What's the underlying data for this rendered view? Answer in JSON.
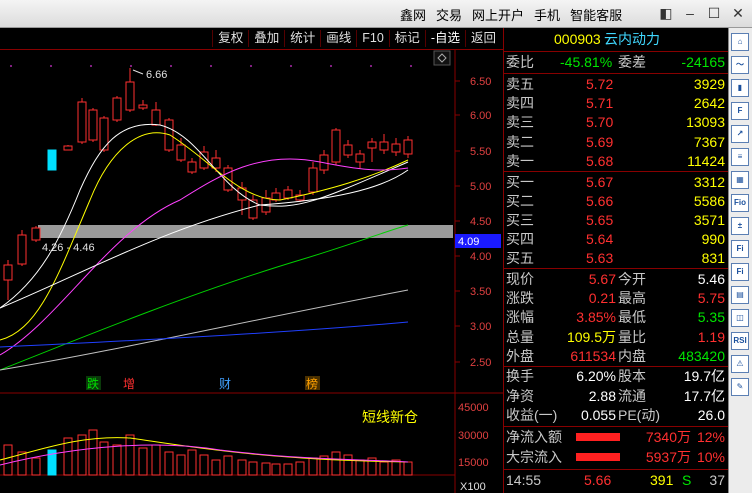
{
  "menu": [
    "鑫网",
    "交易",
    "网上开户",
    "手机",
    "智能客服"
  ],
  "toolbar": [
    "复权",
    "叠加",
    "统计",
    "画线",
    "F10",
    "标记",
    "-自选",
    "返回"
  ],
  "stock": {
    "code": "000903",
    "name": "云内动力"
  },
  "weibi": {
    "label": "委比",
    "value": "-45.81%",
    "label2": "委差",
    "value2": "-24165"
  },
  "asks": [
    {
      "label": "卖五",
      "price": "5.72",
      "vol": "3929"
    },
    {
      "label": "卖四",
      "price": "5.71",
      "vol": "2642"
    },
    {
      "label": "卖三",
      "price": "5.70",
      "vol": "13093"
    },
    {
      "label": "卖二",
      "price": "5.69",
      "vol": "7367"
    },
    {
      "label": "卖一",
      "price": "5.68",
      "vol": "11424"
    }
  ],
  "bids": [
    {
      "label": "买一",
      "price": "5.67",
      "vol": "3312"
    },
    {
      "label": "买二",
      "price": "5.66",
      "vol": "5586"
    },
    {
      "label": "买三",
      "price": "5.65",
      "vol": "3571"
    },
    {
      "label": "买四",
      "price": "5.64",
      "vol": "990"
    },
    {
      "label": "买五",
      "price": "5.63",
      "vol": "831"
    }
  ],
  "quote": [
    {
      "l1": "现价",
      "v1": "5.67",
      "c1": "red",
      "l2": "今开",
      "v2": "5.46",
      "c2": "wht"
    },
    {
      "l1": "涨跌",
      "v1": "0.21",
      "c1": "red",
      "l2": "最高",
      "v2": "5.75",
      "c2": "red"
    },
    {
      "l1": "涨幅",
      "v1": "3.85%",
      "c1": "red",
      "l2": "最低",
      "v2": "5.35",
      "c2": "grn"
    },
    {
      "l1": "总量",
      "v1": "109.5万",
      "c1": "yel",
      "l2": "量比",
      "v2": "1.19",
      "c2": "red"
    },
    {
      "l1": "外盘",
      "v1": "611534",
      "c1": "red",
      "l2": "内盘",
      "v2": "483420",
      "c2": "grn"
    }
  ],
  "fund": [
    {
      "l1": "换手",
      "v1": "6.20%",
      "l2": "股本",
      "v2": "19.7亿"
    },
    {
      "l1": "净资",
      "v1": "2.88",
      "l2": "流通",
      "v2": "17.7亿"
    },
    {
      "l1": "收益(一)",
      "v1": "0.055",
      "l2": "PE(动)",
      "v2": "26.0"
    }
  ],
  "flow": [
    {
      "label": "净流入额",
      "value": "7340万",
      "pct": "12%"
    },
    {
      "label": "大宗流入",
      "value": "5937万",
      "pct": "10%"
    }
  ],
  "tick": {
    "time": "14:55",
    "price": "5.66",
    "vol": "391",
    "side": "S",
    "n": "37"
  },
  "chart": {
    "price_axis": [
      "6.50",
      "6.00",
      "5.50",
      "5.00",
      "4.50",
      "4.00",
      "3.50",
      "3.00",
      "2.50"
    ],
    "current_price_tag": "4.09",
    "high_label": "6.66",
    "range_label": "4.26 - 4.46",
    "event_marks": [
      "跌",
      "增",
      "财",
      "榜"
    ],
    "vol_axis": [
      "45000",
      "30000",
      "15000"
    ],
    "vol_unit": "X100",
    "annotation": "短线新仓"
  },
  "colors": {
    "up": "#ff3030",
    "down": "#00e0ff",
    "ma5": "#ffffff",
    "ma10": "#ffff00",
    "ma20": "#ff40ff",
    "ma60": "#00d000"
  }
}
